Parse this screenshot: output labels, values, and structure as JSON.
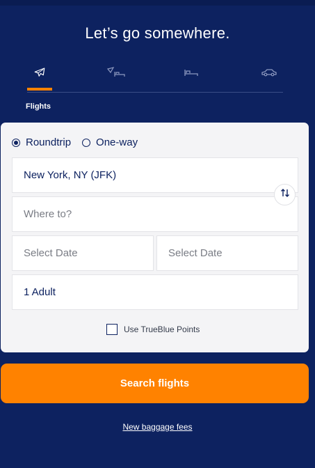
{
  "header": {
    "title": "Let’s go somewhere."
  },
  "tabs": [
    {
      "id": "flights",
      "icon": "plane-icon",
      "label": "Flights",
      "active": true
    },
    {
      "id": "flight-hotel",
      "icon": "plane-bed-icon",
      "active": false
    },
    {
      "id": "hotel",
      "icon": "bed-icon",
      "active": false
    },
    {
      "id": "car",
      "icon": "car-icon",
      "active": false
    }
  ],
  "active_tab_label": "Flights",
  "trip_type": {
    "options": [
      "Roundtrip",
      "One-way"
    ],
    "selected": "Roundtrip"
  },
  "form": {
    "from_value": "New York, NY (JFK)",
    "to_placeholder": "Where to?",
    "depart_placeholder": "Select Date",
    "return_placeholder": "Select Date",
    "passengers_value": "1 Adult",
    "points_label": "Use TrueBlue Points",
    "points_checked": false
  },
  "search_button_label": "Search flights",
  "baggage_link": "New baggage fees",
  "colors": {
    "background": "#0d2260",
    "accent": "#ff8200",
    "card": "#f4f4f6",
    "text_dark": "#0d2260"
  }
}
